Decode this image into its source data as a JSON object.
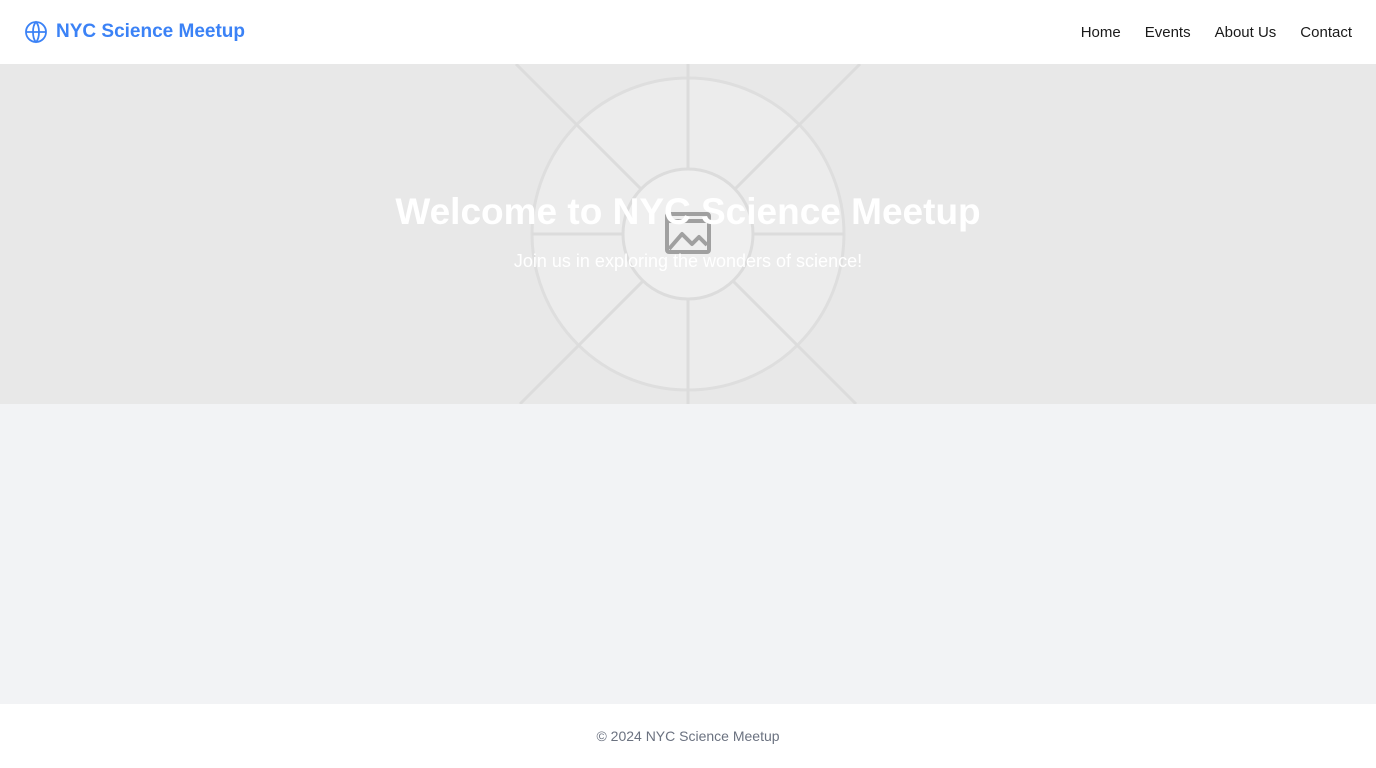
{
  "header": {
    "brand_name": "NYC Science Meetup",
    "brand_icon": "globe-icon",
    "brand_color": "#3b82f6",
    "nav": [
      {
        "label": "Home"
      },
      {
        "label": "Events"
      },
      {
        "label": "About Us"
      },
      {
        "label": "Contact"
      }
    ]
  },
  "hero": {
    "title": "Welcome to NYC Science Meetup",
    "subtitle": "Join us in exploring the wonders of science!",
    "image_icon": "image-placeholder-icon"
  },
  "footer": {
    "copyright": "© 2024 NYC Science Meetup"
  }
}
